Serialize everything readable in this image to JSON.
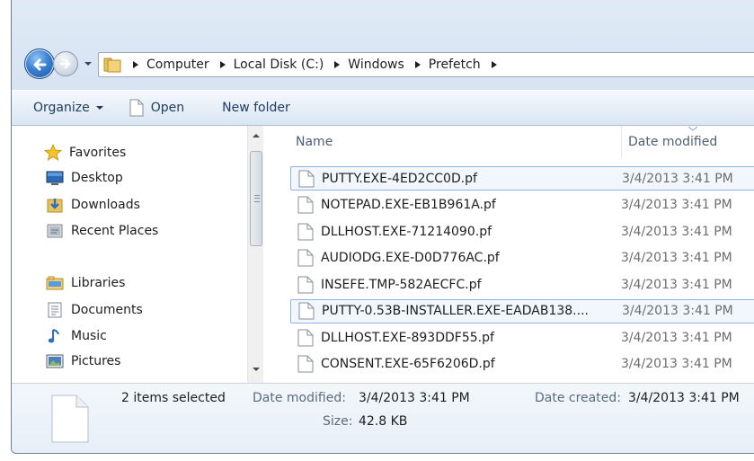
{
  "breadcrumb": [
    "Computer",
    "Local Disk (C:)",
    "Windows",
    "Prefetch"
  ],
  "toolbar": {
    "organize_label": "Organize",
    "open_label": "Open",
    "new_folder_label": "New folder"
  },
  "nav": {
    "favorites": "Favorites",
    "desktop": "Desktop",
    "downloads": "Downloads",
    "recent_places": "Recent Places",
    "libraries": "Libraries",
    "documents": "Documents",
    "music": "Music",
    "pictures": "Pictures"
  },
  "columns": {
    "name": "Name",
    "date_modified": "Date modified"
  },
  "files": [
    {
      "name": "PUTTY.EXE-4ED2CC0D.pf",
      "date": "3/4/2013 3:41 PM",
      "selected": true
    },
    {
      "name": "NOTEPAD.EXE-EB1B961A.pf",
      "date": "3/4/2013 3:41 PM",
      "selected": false
    },
    {
      "name": "DLLHOST.EXE-71214090.pf",
      "date": "3/4/2013 3:41 PM",
      "selected": false
    },
    {
      "name": "AUDIODG.EXE-D0D776AC.pf",
      "date": "3/4/2013 3:41 PM",
      "selected": false
    },
    {
      "name": "INSEFE.TMP-582AECFC.pf",
      "date": "3/4/2013 3:41 PM",
      "selected": false
    },
    {
      "name": "PUTTY-0.53B-INSTALLER.EXE-EADAB138....",
      "date": "3/4/2013 3:41 PM",
      "selected": true
    },
    {
      "name": "DLLHOST.EXE-893DDF55.pf",
      "date": "3/4/2013 3:41 PM",
      "selected": false
    },
    {
      "name": "CONSENT.EXE-65F6206D.pf",
      "date": "3/4/2013 3:41 PM",
      "selected": false
    }
  ],
  "details": {
    "selection_count": "2 items selected",
    "date_modified_label": "Date modified:",
    "date_modified_value": "3/4/2013 3:41 PM",
    "size_label": "Size:",
    "size_value": "42.8 KB",
    "date_created_label": "Date created:",
    "date_created_value": "3/4/2013 3:41 PM"
  },
  "colors": {
    "accent": "#3a7fd0",
    "selection_border": "#8fb3de",
    "selection_fill": "#f2f7fd"
  }
}
